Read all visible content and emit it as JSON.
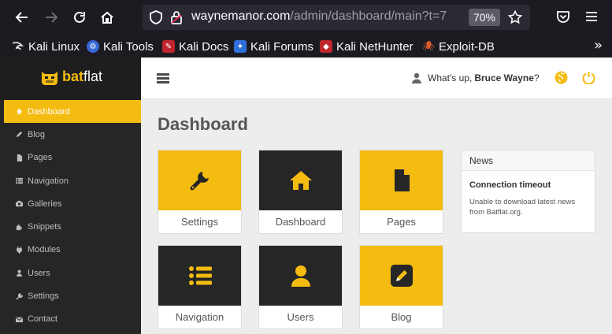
{
  "browser": {
    "url_host": "waynemanor.com",
    "url_path": "/admin/dashboard/main?t=7",
    "zoom": "70%",
    "bookmarks": [
      {
        "label": "Kali Linux",
        "icon": "kali-dragon-icon"
      },
      {
        "label": "Kali Tools",
        "icon": "kali-tools-icon"
      },
      {
        "label": "Kali Docs",
        "icon": "kali-docs-icon"
      },
      {
        "label": "Kali Forums",
        "icon": "kali-forums-icon"
      },
      {
        "label": "Kali NetHunter",
        "icon": "kali-nethunter-icon"
      },
      {
        "label": "Exploit-DB",
        "icon": "exploit-db-icon"
      }
    ]
  },
  "brand": {
    "part1": "bat",
    "part2": "flat"
  },
  "sidebar": {
    "items": [
      {
        "label": "Dashboard",
        "icon": "home-icon",
        "active": true
      },
      {
        "label": "Blog",
        "icon": "pencil-icon"
      },
      {
        "label": "Pages",
        "icon": "file-icon"
      },
      {
        "label": "Navigation",
        "icon": "list-icon"
      },
      {
        "label": "Galleries",
        "icon": "camera-icon"
      },
      {
        "label": "Snippets",
        "icon": "puzzle-icon"
      },
      {
        "label": "Modules",
        "icon": "plug-icon"
      },
      {
        "label": "Users",
        "icon": "user-icon"
      },
      {
        "label": "Settings",
        "icon": "wrench-icon"
      },
      {
        "label": "Contact",
        "icon": "envelope-icon"
      }
    ]
  },
  "topbar": {
    "greeting": "What's up,",
    "name": "Bruce Wayne",
    "suffix": "?"
  },
  "main": {
    "title": "Dashboard",
    "tiles": [
      {
        "label": "Settings",
        "icon": "wrench-icon",
        "style": "yellow"
      },
      {
        "label": "Dashboard",
        "icon": "home-icon",
        "style": "dark"
      },
      {
        "label": "Pages",
        "icon": "file-icon",
        "style": "yellow"
      },
      {
        "label": "Navigation",
        "icon": "list-icon",
        "style": "dark"
      },
      {
        "label": "Users",
        "icon": "user-icon",
        "style": "dark"
      },
      {
        "label": "Blog",
        "icon": "edit-icon",
        "style": "yellow"
      }
    ]
  },
  "news": {
    "header": "News",
    "title": "Connection timeout",
    "body": "Unable to download latest news from Batflat.org."
  },
  "colors": {
    "accent": "#f4bb10",
    "dark": "#262626",
    "chrome": "#1c1b22"
  }
}
